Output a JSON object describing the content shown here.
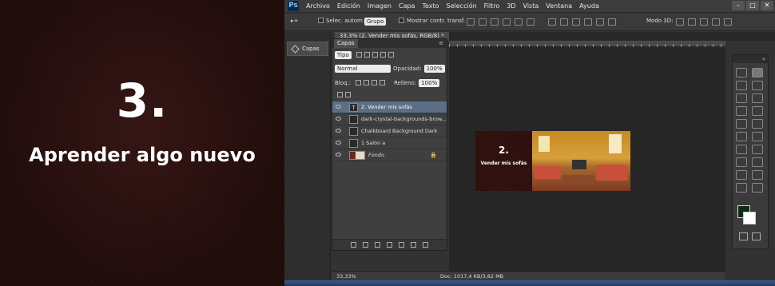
{
  "slide": {
    "number": "3.",
    "title": "Aprender algo nuevo"
  },
  "app": {
    "logo": "Ps",
    "menu": [
      "Archivo",
      "Edición",
      "Imagen",
      "Capa",
      "Texto",
      "Selección",
      "Filtro",
      "3D",
      "Vista",
      "Ventana",
      "Ayuda"
    ],
    "window_controls": [
      "–",
      "□",
      "✕"
    ]
  },
  "options": {
    "auto_select_label": "Selec. autom.:",
    "auto_select_value": "Grupo",
    "show_transform_label": "Mostrar contr. transf.",
    "mode_3d_label": "Modo 3D:"
  },
  "document_tab": "33,3% (2.  Vender mis sofás, RGB/8) *",
  "dock": {
    "capas_label": "Capas"
  },
  "layers_panel": {
    "tab_label": "Capas",
    "filter_label": "Tipo",
    "blend_mode": "Normal",
    "opacity_label": "Opacidad:",
    "opacity_value": "100%",
    "lock_label": "Bloq.:",
    "fill_label": "Relleno:",
    "fill_value": "100%",
    "layers": [
      {
        "name": "2.  Vender mis sofás",
        "thumb": "T",
        "selected": true
      },
      {
        "name": "dark-crystal-backgrounds-brow...",
        "thumb": "",
        "selected": false
      },
      {
        "name": "Chalkboard Background Dark",
        "thumb": "",
        "selected": false
      },
      {
        "name": "1 Salón a",
        "thumb": "",
        "selected": false
      },
      {
        "name": "Fondo",
        "thumb": "img",
        "selected": false
      }
    ]
  },
  "artwork": {
    "number": "2.",
    "text": "Vender mis sofás"
  },
  "status": {
    "zoom": "33,33%",
    "doc": "Doc: 1017,4 KB/3,82 MB"
  },
  "colors": {
    "foreground": "#0d2b0d",
    "background": "#ffffff",
    "selected_layer": "#5b6f86"
  }
}
